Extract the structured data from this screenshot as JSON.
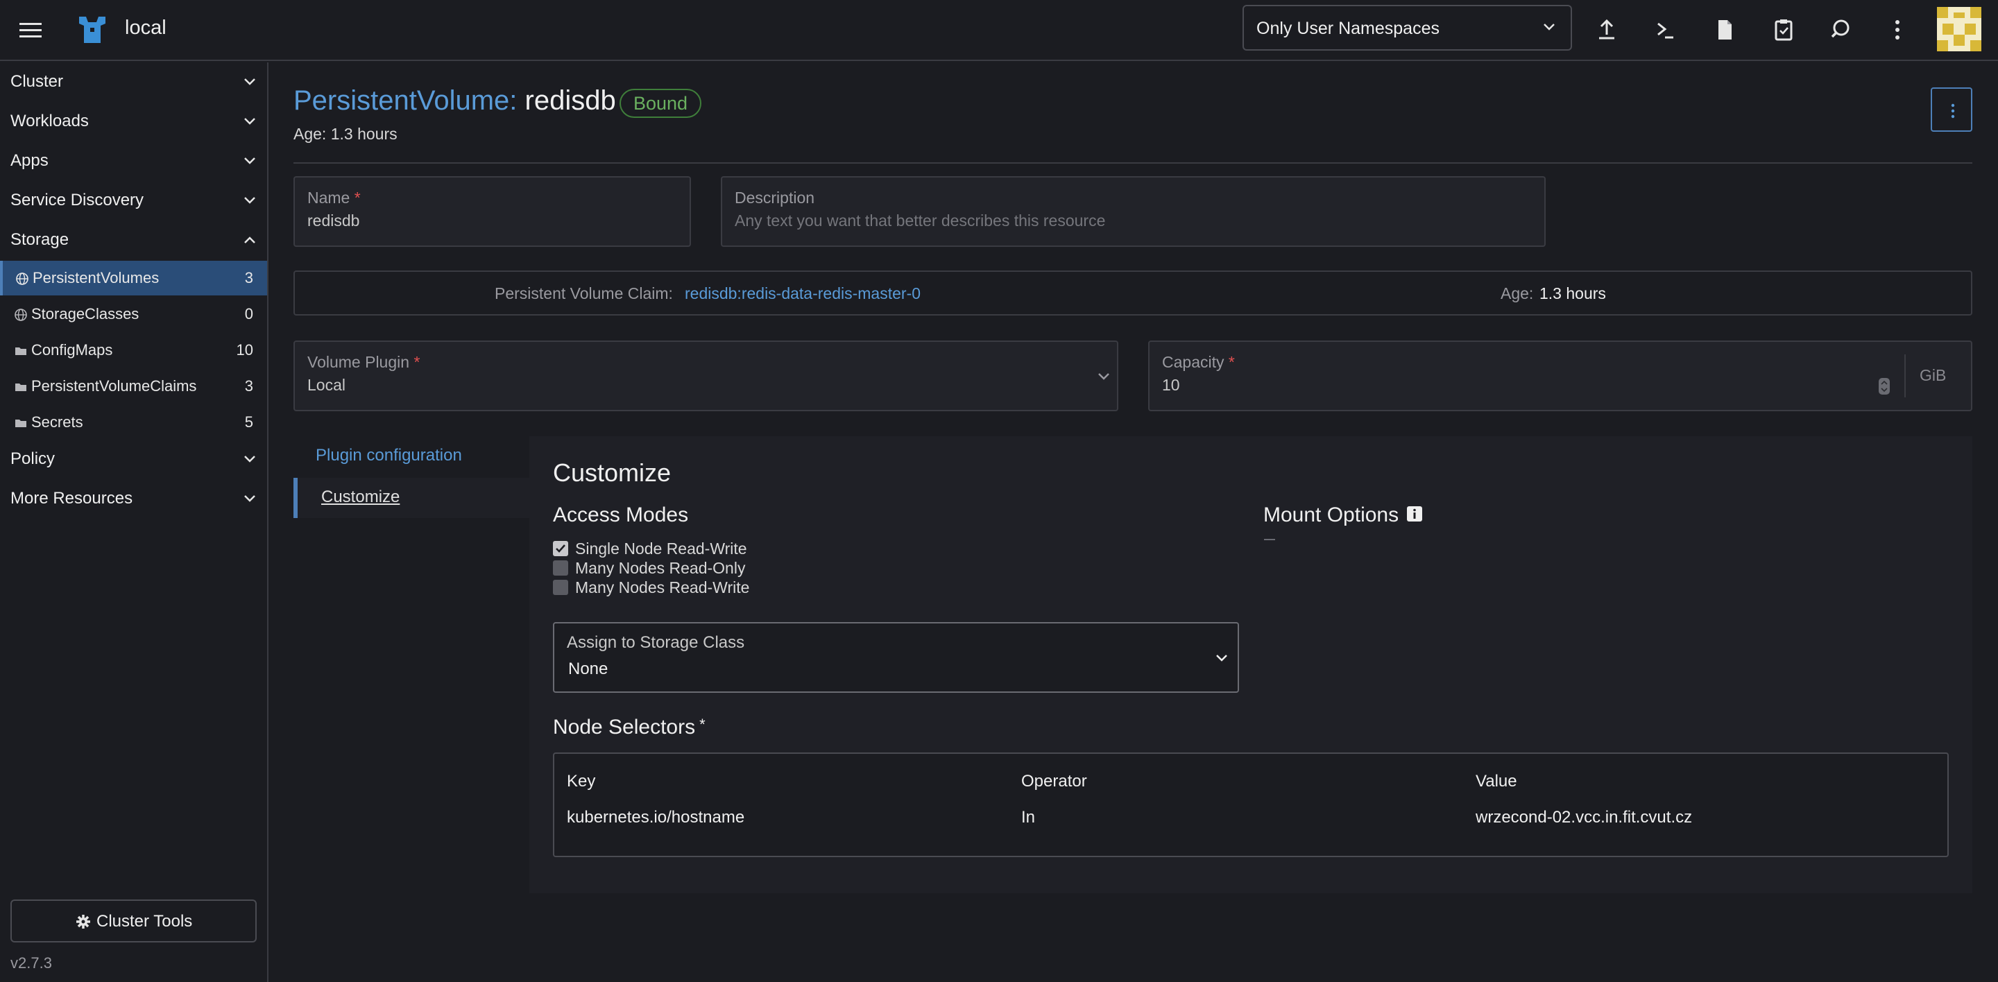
{
  "header": {
    "cluster_name": "local",
    "namespace_filter": "Only User Namespaces",
    "icons": [
      "menu-icon",
      "rancher-logo-icon",
      "upload-icon",
      "terminal-icon",
      "file-icon",
      "copy-config-icon",
      "search-icon",
      "more-vertical-icon",
      "user-avatar"
    ]
  },
  "sidebar": {
    "groups": {
      "cluster": "Cluster",
      "workloads": "Workloads",
      "apps": "Apps",
      "service_discovery": "Service Discovery",
      "storage": "Storage",
      "policy": "Policy",
      "more_resources": "More Resources"
    },
    "storage_items": [
      {
        "label": "PersistentVolumes",
        "count": "3",
        "icon": "globe-icon",
        "active": true
      },
      {
        "label": "StorageClasses",
        "count": "0",
        "icon": "globe-icon"
      },
      {
        "label": "ConfigMaps",
        "count": "10",
        "icon": "folder-icon"
      },
      {
        "label": "PersistentVolumeClaims",
        "count": "3",
        "icon": "folder-icon"
      },
      {
        "label": "Secrets",
        "count": "5",
        "icon": "folder-icon"
      }
    ],
    "cluster_tools": "Cluster Tools",
    "version": "v2.7.3"
  },
  "page": {
    "kind": "PersistentVolume:",
    "name": "redisdb",
    "status": "Bound",
    "age": "Age: 1.3 hours"
  },
  "form": {
    "name_label": "Name",
    "name_required": "*",
    "name_value": "redisdb",
    "description_label": "Description",
    "description_placeholder": "Any text you want that better describes this resource",
    "pvc_label": "Persistent Volume Claim:",
    "pvc_value": "redisdb:redis-data-redis-master-0",
    "age_label": "Age:",
    "age_value": "1.3 hours",
    "volume_plugin_label": "Volume Plugin",
    "volume_plugin_required": "*",
    "volume_plugin_value": "Local",
    "capacity_label": "Capacity",
    "capacity_required": "*",
    "capacity_value": "10",
    "capacity_unit": "GiB"
  },
  "tabs": {
    "plugin_configuration": "Plugin configuration",
    "customize": "Customize",
    "active": "customize"
  },
  "customize": {
    "title": "Customize",
    "access_modes_title": "Access Modes",
    "access_modes": [
      {
        "label": "Single Node Read-Write",
        "checked": true
      },
      {
        "label": "Many Nodes Read-Only",
        "checked": false
      },
      {
        "label": "Many Nodes Read-Write",
        "checked": false
      }
    ],
    "mount_options_title": "Mount Options",
    "mount_options_value": "—",
    "storage_class_label": "Assign to Storage Class",
    "storage_class_value": "None",
    "node_selectors_title": "Node Selectors",
    "node_selectors_required": "*",
    "table": {
      "headers": [
        "Key",
        "Operator",
        "Value"
      ],
      "rows": [
        [
          "kubernetes.io/hostname",
          "In",
          "wrzecond-02.vcc.in.fit.cvut.cz"
        ]
      ]
    }
  },
  "colors": {
    "accent": "#5a9bd8",
    "active_nav": "#2a4d78",
    "bound_badge": "#6ab05f",
    "background": "#1b1c21"
  }
}
